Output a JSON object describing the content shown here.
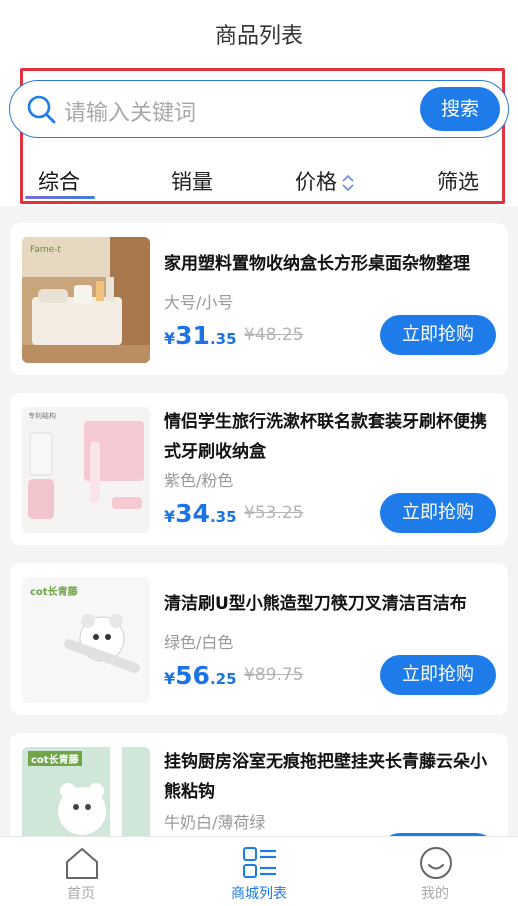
{
  "page_title": "商品列表",
  "search": {
    "placeholder": "请输入关键词",
    "button_label": "搜索"
  },
  "tabs": [
    {
      "label": "综合",
      "active": true
    },
    {
      "label": "销量",
      "active": false
    },
    {
      "label": "价格",
      "active": false
    },
    {
      "label": "筛选",
      "active": false
    }
  ],
  "products": [
    {
      "name": "家用塑料置物收纳盒长方形桌面杂物整理",
      "variant": "大号/小号",
      "price_symbol": "¥",
      "price_int": "31",
      "price_dec": ".35",
      "old_price": "¥48.25",
      "buy_label": "立即抢购",
      "thumb_caption": "Fame-t"
    },
    {
      "name": "情侣学生旅行洗漱杯联名款套装牙刷杯便携式牙刷收纳盒",
      "variant": "紫色/粉色",
      "price_symbol": "¥",
      "price_int": "34",
      "price_dec": ".35",
      "old_price": "¥53.25",
      "buy_label": "立即抢购",
      "thumb_caption": "专利结构"
    },
    {
      "name": "清洁刷U型小熊造型刀筷刀叉清洁百洁布",
      "variant": "绿色/白色",
      "price_symbol": "¥",
      "price_int": "56",
      "price_dec": ".25",
      "old_price": "¥89.75",
      "buy_label": "立即抢购",
      "thumb_caption": "cot长青藤"
    },
    {
      "name": "挂钩厨房浴室无痕拖把壁挂夹长青藤云朵小熊粘钩",
      "variant": "牛奶白/薄荷绿",
      "price_symbol": "¥",
      "price_int": "",
      "price_dec": "",
      "old_price": "",
      "buy_label": "",
      "thumb_caption": "cot长青藤"
    }
  ],
  "tabbar": [
    {
      "label": "首页",
      "icon": "home-icon",
      "active": false
    },
    {
      "label": "商城列表",
      "icon": "list-icon",
      "active": true
    },
    {
      "label": "我的",
      "icon": "smile-icon",
      "active": false
    }
  ],
  "colors": {
    "accent": "#1e7bea",
    "highlight_border": "#e0333d"
  }
}
